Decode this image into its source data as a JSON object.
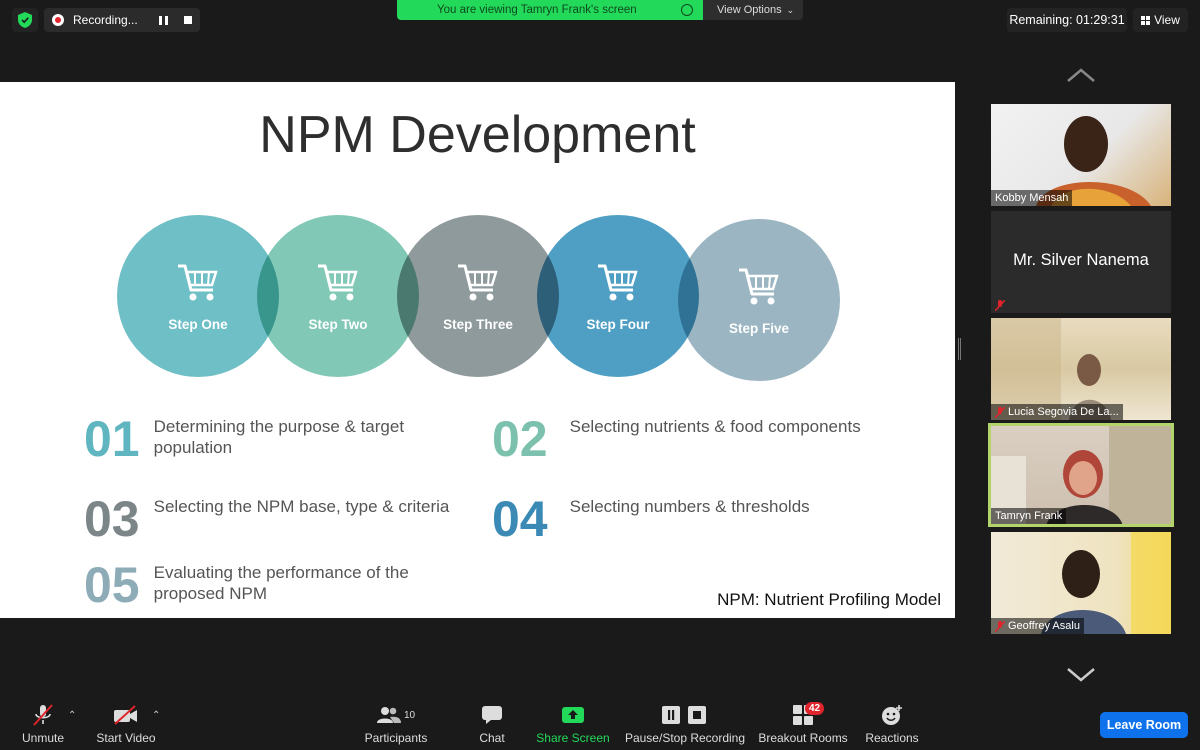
{
  "topbar": {
    "recording_label": "Recording...",
    "viewing_banner": "You are viewing Tamryn Frank's screen",
    "view_options": "View Options",
    "remaining": "Remaining: 01:29:31",
    "view_label": "View"
  },
  "slide": {
    "title": "NPM Development",
    "steps": [
      {
        "label": "Step One",
        "color": "#6fbfc6"
      },
      {
        "label": "Step Two",
        "color": "#82c8b6"
      },
      {
        "label": "Step Three",
        "color": "#8f9a9c"
      },
      {
        "label": "Step Four",
        "color": "#4f9fc4"
      },
      {
        "label": "Step Five",
        "color": "#9bb6c2"
      }
    ],
    "items": [
      {
        "num": "01",
        "text": "Determining the purpose & target population",
        "color": "#5fb5c0"
      },
      {
        "num": "02",
        "text": "Selecting nutrients & food components",
        "color": "#7cc1ad"
      },
      {
        "num": "03",
        "text": "Selecting the NPM base, type & criteria",
        "color": "#7c8587"
      },
      {
        "num": "04",
        "text": "Selecting numbers & thresholds",
        "color": "#3b8ab5"
      },
      {
        "num": "05",
        "text": "Evaluating the performance of the proposed NPM",
        "color": "#8eacb8"
      }
    ],
    "footnote": "NPM: Nutrient Profiling Model"
  },
  "participants_panel": {
    "tiles": [
      {
        "name": "Kobby Mensah",
        "muted": false
      },
      {
        "name": "Mr. Silver Nanema",
        "muted": true
      },
      {
        "name": "Lucia Segovia De La...",
        "muted": true
      },
      {
        "name": "Tamryn Frank",
        "muted": false
      },
      {
        "name": "Geoffrey Asalu",
        "muted": true
      }
    ]
  },
  "toolbar": {
    "unmute": "Unmute",
    "start_video": "Start Video",
    "participants": "Participants",
    "participants_count": "10",
    "chat": "Chat",
    "share_screen": "Share Screen",
    "pause_stop_recording": "Pause/Stop Recording",
    "breakout_rooms": "Breakout Rooms",
    "breakout_badge": "42",
    "reactions": "Reactions",
    "leave_room": "Leave Room"
  },
  "colors": {
    "accent_green": "#23d959",
    "leave_blue": "#0e72ed",
    "mute_red": "#e0242c",
    "active_speaker_border": "#b3d46a"
  }
}
